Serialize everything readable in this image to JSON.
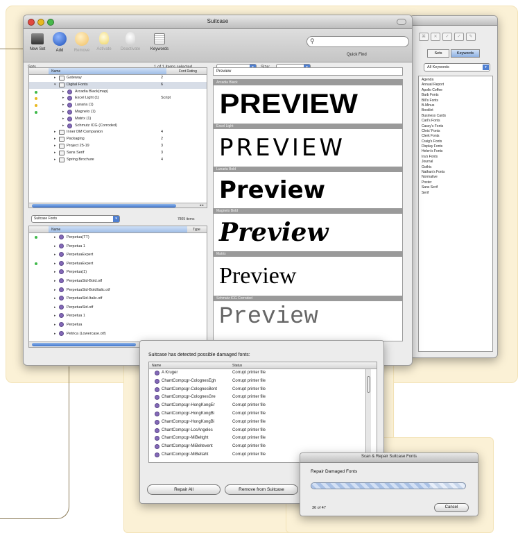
{
  "main_window": {
    "title": "Suitcase",
    "toolbar": [
      {
        "label": "New Set",
        "icon": "new-set-icon",
        "enabled": true
      },
      {
        "label": "Add",
        "icon": "add-icon",
        "enabled": true
      },
      {
        "label": "Remove",
        "icon": "remove-icon",
        "enabled": false
      },
      {
        "label": "Activate",
        "icon": "activate-icon",
        "enabled": false
      },
      {
        "label": "Deactivate",
        "icon": "deactivate-icon",
        "enabled": false
      },
      {
        "label": "Keywords",
        "icon": "keywords-icon",
        "enabled": true
      }
    ],
    "quick_find_label": "Quick Find",
    "sets_label": "Sets",
    "selection_status": "1 of 1 items selected",
    "preview_type": "Quick Type",
    "size_label": "Size:",
    "size_value": "12",
    "sets_columns": [
      "Name",
      "Font Rating"
    ],
    "sets_rows": [
      {
        "name": "Gateway",
        "rating": "2",
        "dot": null,
        "indent": 1,
        "kind": "folder",
        "open": false,
        "selected": false
      },
      {
        "name": "Digital Fonts",
        "rating": "6",
        "dot": null,
        "indent": 1,
        "kind": "folder",
        "open": true,
        "selected": true
      },
      {
        "name": "Arcadia Black(map)",
        "rating": "",
        "dot": "#3fb94a",
        "indent": 2,
        "kind": "font",
        "open": false,
        "selected": false
      },
      {
        "name": "Excel Light (1)",
        "rating": "Script",
        "dot": "#e8b820",
        "indent": 2,
        "kind": "font",
        "open": false,
        "selected": false
      },
      {
        "name": "Lunaria (1)",
        "rating": "",
        "dot": "#e8b820",
        "indent": 2,
        "kind": "font",
        "open": false,
        "selected": false
      },
      {
        "name": "Magneto (1)",
        "rating": "",
        "dot": "#3fb94a",
        "indent": 2,
        "kind": "font",
        "open": false,
        "selected": false
      },
      {
        "name": "Matrix (1)",
        "rating": "",
        "dot": null,
        "indent": 2,
        "kind": "font",
        "open": false,
        "selected": false
      },
      {
        "name": "Schmutz ICG (Corroded)",
        "rating": "",
        "dot": null,
        "indent": 2,
        "kind": "font",
        "open": false,
        "selected": false
      },
      {
        "name": "Inner DM Companion",
        "rating": "4",
        "dot": null,
        "indent": 1,
        "kind": "folder",
        "open": false,
        "selected": false
      },
      {
        "name": "Packaging",
        "rating": "2",
        "dot": null,
        "indent": 1,
        "kind": "folder",
        "open": false,
        "selected": false
      },
      {
        "name": "Project 25-19",
        "rating": "3",
        "dot": null,
        "indent": 1,
        "kind": "folder",
        "open": false,
        "selected": false
      },
      {
        "name": "Sans Serif",
        "rating": "3",
        "dot": null,
        "indent": 1,
        "kind": "folder",
        "open": false,
        "selected": false
      },
      {
        "name": "Spring Brochure",
        "rating": "4",
        "dot": null,
        "indent": 1,
        "kind": "folder",
        "open": false,
        "selected": false
      }
    ],
    "fonts_source": "Suitcase Fonts",
    "fonts_count": "7805 items",
    "fonts_columns": [
      "Name",
      "Type"
    ],
    "fonts_rows": [
      {
        "name": "Perpetua(TT)",
        "dot": "#3fb94a"
      },
      {
        "name": "Perpetua 1",
        "dot": null
      },
      {
        "name": "PerpetuaExpert",
        "dot": null
      },
      {
        "name": "PerpetuaExpert",
        "dot": "#3fb94a"
      },
      {
        "name": "Perpetua(1)",
        "dot": null
      },
      {
        "name": "PerpetuaStd-Bold.otf",
        "dot": null
      },
      {
        "name": "PerpetuaStd-BoldItalic.otf",
        "dot": null
      },
      {
        "name": "PerpetuaStd-Italic.otf",
        "dot": null
      },
      {
        "name": "PerpetuaStd.otf",
        "dot": null
      },
      {
        "name": "Perpetua 1",
        "dot": null
      },
      {
        "name": "Perpetua",
        "dot": null
      },
      {
        "name": "Petrica (Lowercase.otf)",
        "dot": null
      }
    ],
    "preview_text": "Preview",
    "previews": [
      {
        "font": "Arcadia Black",
        "sample": "PREVIEW",
        "style": "arcadia"
      },
      {
        "font": "Excel Light",
        "sample": "PREVIEW",
        "style": "excel"
      },
      {
        "font": "Lunaria Bold",
        "sample": "Preview",
        "style": "lunaria"
      },
      {
        "font": "Magneto Bold",
        "sample": "Preview",
        "style": "magneto"
      },
      {
        "font": "Matrix",
        "sample": "Preview",
        "style": "matrix"
      },
      {
        "font": "Schmutz ICG Corroded",
        "sample": "Preview",
        "style": "schmutz"
      }
    ]
  },
  "keywords_panel": {
    "tabs": [
      "Sets",
      "Keywords"
    ],
    "active_tab": "Keywords",
    "filter": "All Keywords",
    "items": [
      "Agenda",
      "Annual Report",
      "Apollo Coffee",
      "Barb Fonts",
      "Bill's Fonts",
      "B-Minus",
      "Booklet",
      "Business Cards",
      "Carl's Fonts",
      "Cassy's Fonts",
      "Chris' Fonts",
      "Clerk Fonts",
      "Craig's Fonts",
      "Display Fonts",
      "Helen's Fonts",
      "Ira's Fonts",
      "Journal",
      "Gothic",
      "Nathan's Fonts",
      "Normative",
      "Poster",
      "Sans Serif",
      "Serif"
    ]
  },
  "damaged_dialog": {
    "message": "Suitcase has detected possible damaged fonts:",
    "columns": [
      "Name",
      "Status"
    ],
    "rows": [
      {
        "name": "A Kruger",
        "status": "Corrupt printer file"
      },
      {
        "name": "ChantCompcgr-ColognesEgh",
        "status": "Corrupt printer file"
      },
      {
        "name": "ChantCompcgr-ColognesBent",
        "status": "Corrupt printer file"
      },
      {
        "name": "ChantCompcgr-ColognesGre",
        "status": "Corrupt printer file"
      },
      {
        "name": "ChantCompcgr-HongKongEr",
        "status": "Corrupt printer file"
      },
      {
        "name": "ChantCompcgr-HongKongBi",
        "status": "Corrupt printer file"
      },
      {
        "name": "ChantCompcgr-HongKongBi",
        "status": "Corrupt printer file"
      },
      {
        "name": "ChantCompcgr-LosAngeles",
        "status": "Corrupt printer file"
      },
      {
        "name": "ChantCompcgr-MiBeltght",
        "status": "Corrupt printer file"
      },
      {
        "name": "ChantCompcgr-MiBeltevent",
        "status": "Corrupt printer file"
      },
      {
        "name": "ChantCompcgr-MiBeltaht",
        "status": "Corrupt printer file"
      }
    ],
    "repair_all": "Repair All",
    "remove_from_suitcase": "Remove from Suitcase"
  },
  "repair_dialog": {
    "title": "Scan & Repair Suitcase Fonts",
    "label": "Repair Damaged Fonts",
    "progress_text": "36 of 47",
    "progress": 0.77,
    "cancel": "Cancel"
  },
  "colors": {
    "cream": "#fbf1d6",
    "selection": "#d7dde7",
    "aqua_blue": "#3f75cc",
    "font_icon": "#8469b8",
    "green_dot": "#3fb94a",
    "yellow_dot": "#e8b820"
  }
}
